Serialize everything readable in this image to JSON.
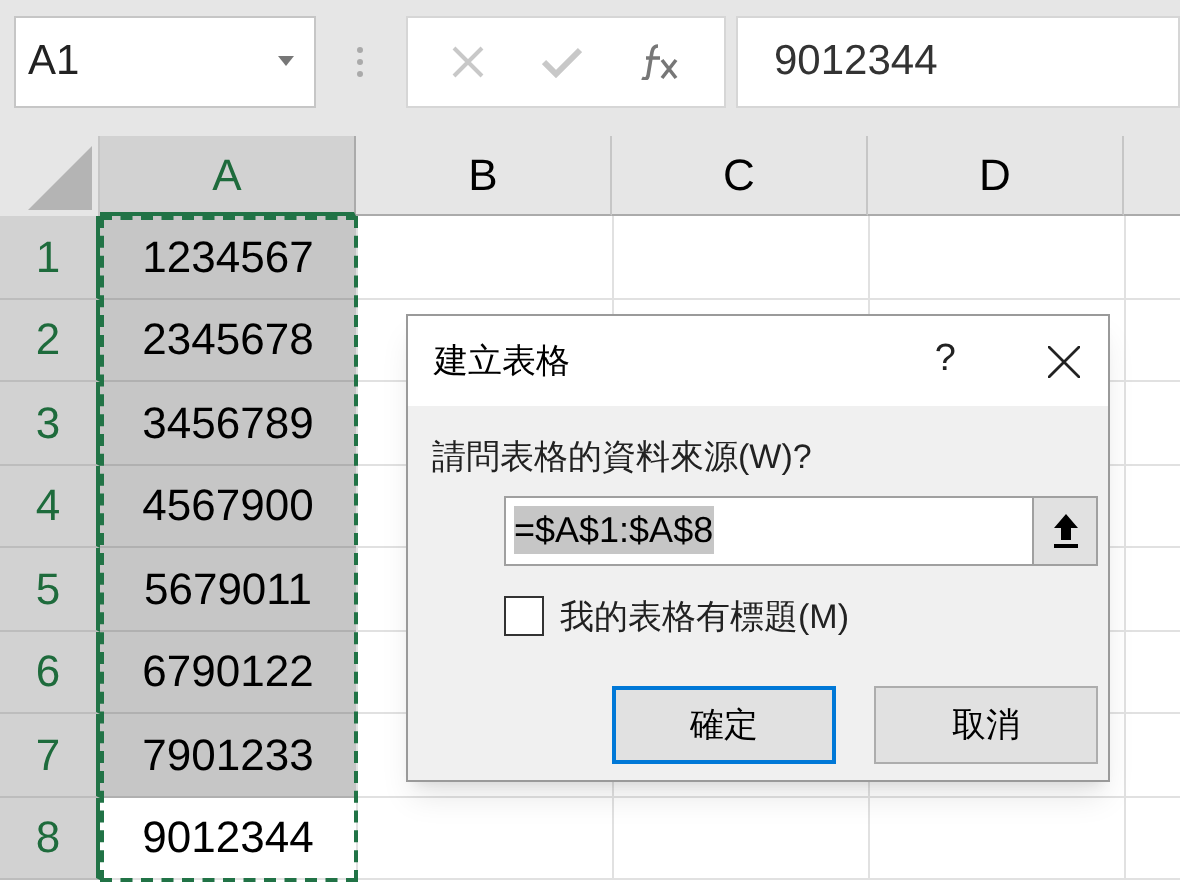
{
  "name_box": {
    "value": "A1"
  },
  "formula_bar": {
    "value": "9012344"
  },
  "columns": [
    {
      "label": "A",
      "selected": true
    },
    {
      "label": "B",
      "selected": false
    },
    {
      "label": "C",
      "selected": false
    },
    {
      "label": "D",
      "selected": false
    }
  ],
  "rows": [
    {
      "label": "1",
      "selected": true,
      "cell": {
        "value": "1234567",
        "highlighted": true
      }
    },
    {
      "label": "2",
      "selected": true,
      "cell": {
        "value": "2345678",
        "highlighted": true
      }
    },
    {
      "label": "3",
      "selected": true,
      "cell": {
        "value": "3456789",
        "highlighted": true
      }
    },
    {
      "label": "4",
      "selected": true,
      "cell": {
        "value": "4567900",
        "highlighted": true
      }
    },
    {
      "label": "5",
      "selected": true,
      "cell": {
        "value": "5679011",
        "highlighted": true
      }
    },
    {
      "label": "6",
      "selected": true,
      "cell": {
        "value": "6790122",
        "highlighted": true
      }
    },
    {
      "label": "7",
      "selected": true,
      "cell": {
        "value": "7901233",
        "highlighted": true
      }
    },
    {
      "label": "8",
      "selected": true,
      "cell": {
        "value": "9012344",
        "highlighted": false
      }
    }
  ],
  "dialog": {
    "title": "建立表格",
    "help": "?",
    "prompt": "請問表格的資料來源(W)?",
    "range_field": {
      "value": "=$A$1:$A$8"
    },
    "checkbox": {
      "label": "我的表格有標題(M)",
      "checked": false
    },
    "buttons": [
      {
        "label": "確定",
        "default": true
      },
      {
        "label": "取消",
        "default": false
      }
    ]
  }
}
